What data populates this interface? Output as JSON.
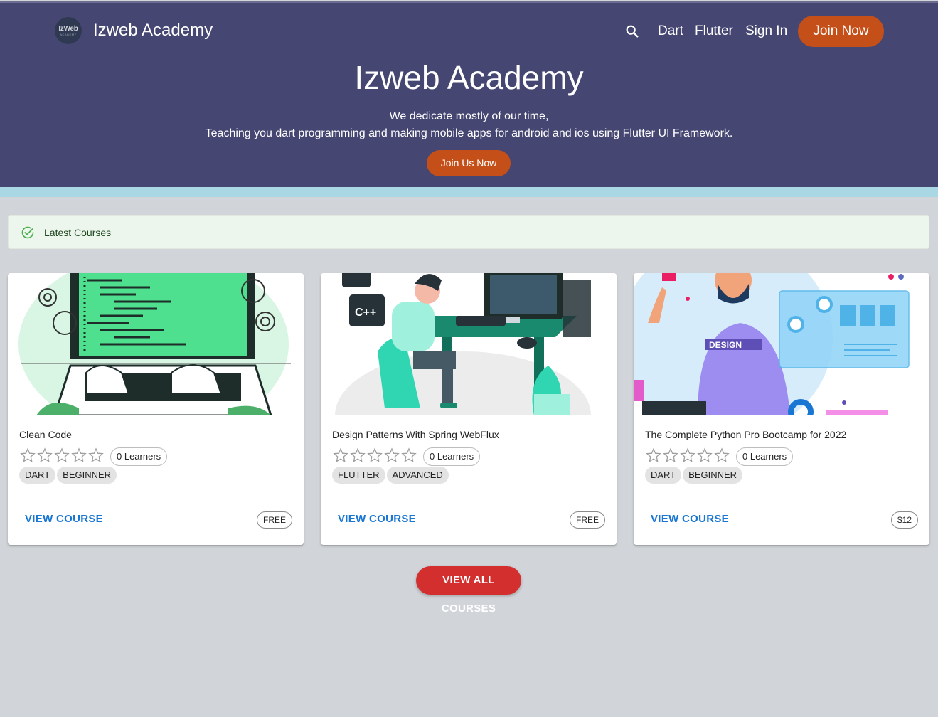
{
  "header": {
    "logo_text": "IzWeb",
    "logo_subtext": "ACADEMY",
    "brand": "Izweb Academy",
    "nav": [
      "Dart",
      "Flutter",
      "Sign In"
    ],
    "join_label": "Join Now",
    "search_icon": "search-icon"
  },
  "hero": {
    "title": "Izweb Academy",
    "subtitle_line1": "We dedicate mostly of our time,",
    "subtitle_line2": "Teaching you dart programming and making mobile apps for android and ios using Flutter UI Framework.",
    "cta_label": "Join Us Now"
  },
  "alert": {
    "icon": "check-circle-icon",
    "text": "Latest Courses"
  },
  "courses": [
    {
      "title": "Clean Code",
      "rating": 0,
      "learners": "0 Learners",
      "tags": [
        "DART",
        "BEGINNER"
      ],
      "action": "VIEW COURSE",
      "price": "FREE"
    },
    {
      "title": "Design Patterns With Spring WebFlux",
      "rating": 0,
      "learners": "0 Learners",
      "tags": [
        "FLUTTER",
        "ADVANCED"
      ],
      "action": "VIEW COURSE",
      "price": "FREE"
    },
    {
      "title": "The Complete Python Pro Bootcamp for 2022",
      "rating": 0,
      "learners": "0 Learners",
      "tags": [
        "DART",
        "BEGINNER"
      ],
      "action": "VIEW COURSE",
      "price": "$12"
    }
  ],
  "view_all_label": "VIEW ALL COURSES",
  "colors": {
    "header_bg": "#454672",
    "accent_orange": "#c54f18",
    "link_blue": "#1976d2",
    "view_all_red": "#d32f2f",
    "page_bg": "#d1d4d8"
  }
}
